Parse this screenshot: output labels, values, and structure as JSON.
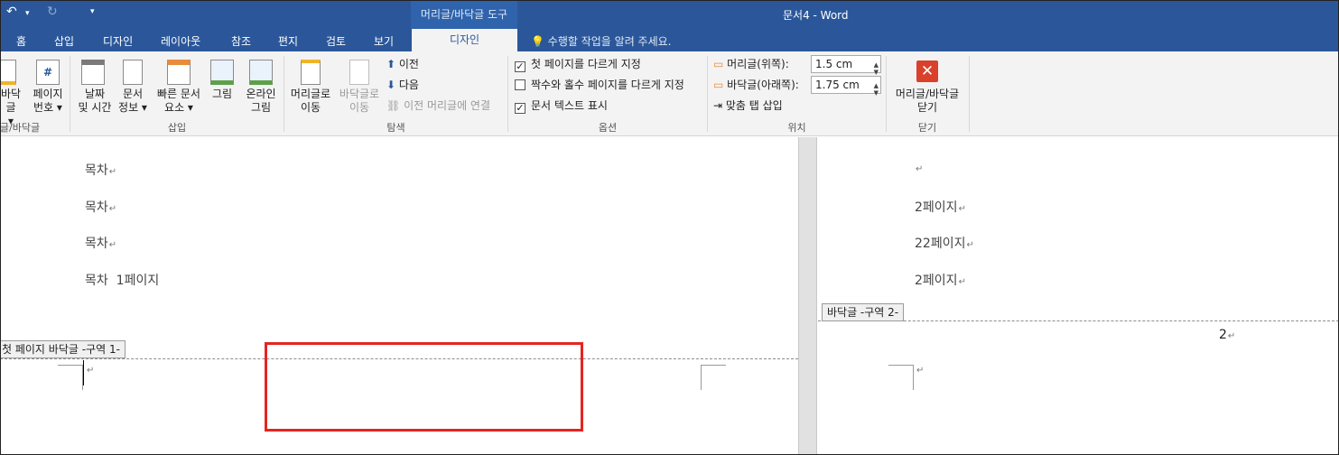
{
  "titlebar": {
    "context_group": "머리글/바닥글 도구",
    "window_title": "문서4 - Word"
  },
  "tabs": [
    "홈",
    "삽입",
    "디자인",
    "레이아웃",
    "참조",
    "편지",
    "검토",
    "보기",
    "디자인"
  ],
  "tell_me": "수행할 작업을 알려 주세요.",
  "ribbon": {
    "header_footer_group": {
      "footer_btn": [
        "바닥글",
        "▾"
      ],
      "page_number_btn": [
        "페이지",
        "번호 ▾"
      ],
      "label": "글/바닥글"
    },
    "insert_group": {
      "date_time": [
        "날짜",
        "및 시간"
      ],
      "doc_info": [
        "문서",
        "정보 ▾"
      ],
      "quick_parts": [
        "빠른 문서",
        "요소 ▾"
      ],
      "pictures": "그림",
      "online_pictures": [
        "온라인",
        "그림"
      ],
      "label": "삽입"
    },
    "navigation_group": {
      "goto_header": [
        "머리글로",
        "이동"
      ],
      "goto_footer": [
        "바닥글로",
        "이동"
      ],
      "previous": "이전",
      "next": "다음",
      "link_previous": "이전 머리글에 연결",
      "label": "탐색"
    },
    "options_group": {
      "different_first": "첫 페이지를 다르게 지정",
      "different_odd_even": "짝수와 홀수 페이지를 다르게 지정",
      "show_doc_text": "문서 텍스트 표시",
      "different_first_checked": true,
      "different_odd_even_checked": false,
      "show_doc_text_checked": true,
      "label": "옵션"
    },
    "position_group": {
      "header_from_top_label": "머리글(위쪽):",
      "header_from_top_value": "1.5 cm",
      "footer_from_bottom_label": "바닥글(아래쪽):",
      "footer_from_bottom_value": "1.75 cm",
      "insert_align_tab": "맞춤 탭 삽입",
      "label": "위치"
    },
    "close_group": {
      "close_btn": [
        "머리글/바닥글",
        "닫기"
      ],
      "label": "닫기"
    }
  },
  "document": {
    "left_page": {
      "lines": [
        "목차",
        "목차",
        "목차",
        "목차  1페이지"
      ],
      "footer_tag": "첫 페이지 바닥글 -구역 1-"
    },
    "right_page": {
      "lines": [
        "",
        "2페이지",
        "22페이지",
        "2페이지"
      ],
      "footer_tag": "바닥글 -구역 2-",
      "page_number": "2"
    },
    "para_mark": "↵"
  }
}
